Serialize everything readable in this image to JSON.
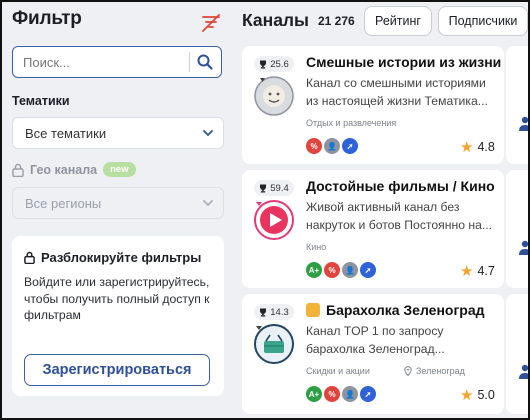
{
  "sidebar": {
    "title": "Фильтр",
    "search_placeholder": "Поиск...",
    "topics_label": "Тематики",
    "topics_value": "Все тематики",
    "geo_label": "Гео канала",
    "geo_badge": "new",
    "geo_value": "Все регионы",
    "unlock": {
      "title": "Разблокируйте фильтры",
      "text": "Войдите или зарегистрируйтесь, чтобы получить полный доступ к фильтрам",
      "button": "Зарегистрироваться"
    }
  },
  "main": {
    "title": "Каналы",
    "count": "21 276",
    "sort_rating": "Рейтинг",
    "sort_subscribers": "Подписчики",
    "channels": [
      {
        "rating": "25.6",
        "title": "Смешные истории из жизни",
        "description": "Канал со смешными историями из настоящей жизни Тематика...",
        "category": "Отдых и развлечения",
        "geo": "",
        "tags": [
          "%",
          "person",
          "rocket"
        ],
        "stars": "4.8"
      },
      {
        "rating": "59.4",
        "title": "Достойные фильмы / Кино",
        "description": "Живой активный канал без накруток и ботов Постоянно на...",
        "category": "Кино",
        "geo": "",
        "tags": [
          "A+",
          "%",
          "person",
          "rocket"
        ],
        "stars": "4.7"
      },
      {
        "rating": "14.3",
        "title": "Барахолка Зеленоград",
        "description": "Канал TOP 1 по запросу барахолка Зеленоград...",
        "category": "Скидки и акции",
        "geo": "Зеленоград",
        "tags": [
          "A+",
          "%",
          "person",
          "rocket"
        ],
        "stars": "5.0"
      }
    ]
  },
  "colors": {
    "accent": "#3d5fa8",
    "tag_green": "#2ea043",
    "tag_red": "#e0443c",
    "tag_gray": "#8e949e",
    "tag_blue": "#2d62d8",
    "star": "#f2a52b"
  }
}
